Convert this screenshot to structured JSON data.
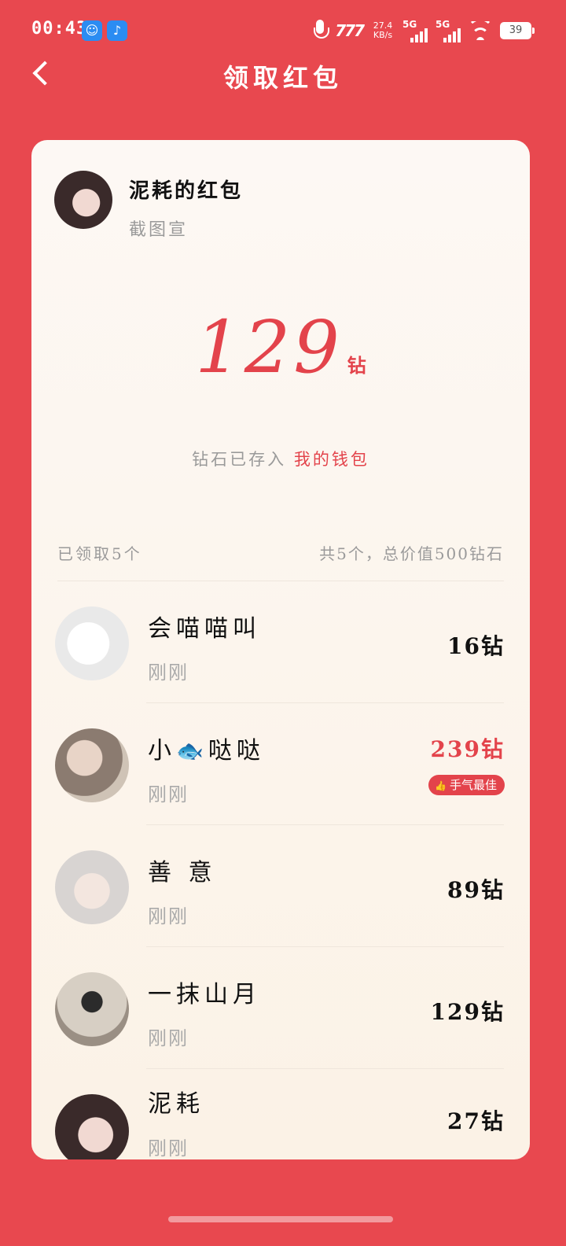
{
  "status_bar": {
    "time": "00:43",
    "net_speed": "27.4",
    "net_unit": "KB/s",
    "sim1": "5G",
    "sim2": "5G",
    "battery": "39"
  },
  "nav": {
    "title": "领取红包"
  },
  "sender": {
    "name": "泥耗的红包",
    "subtitle": "截图宣"
  },
  "amount": {
    "value": "129",
    "unit": "钻"
  },
  "wallet_note": {
    "prefix": "钻石已存入",
    "link": "我的钱包"
  },
  "summary": {
    "claimed": "已领取5个",
    "total": "共5个，总价值500钻石"
  },
  "claims": [
    {
      "name": "会喵喵叫",
      "time": "刚刚",
      "amount": "16钻"
    },
    {
      "name_prefix": "小",
      "name_icon": "🐟",
      "name_suffix": "哒哒",
      "time": "刚刚",
      "amount": "239钻",
      "badge": "手气最佳"
    },
    {
      "name": "善 意",
      "time": "刚刚",
      "amount": "89钻"
    },
    {
      "name": "一抹山月",
      "time": "刚刚",
      "amount": "129钻"
    },
    {
      "name": "泥耗",
      "time": "刚刚",
      "amount": "27钻"
    }
  ],
  "colors": {
    "background": "#E8484F",
    "accent": "#E3434B",
    "card": "#FDF8F4"
  }
}
